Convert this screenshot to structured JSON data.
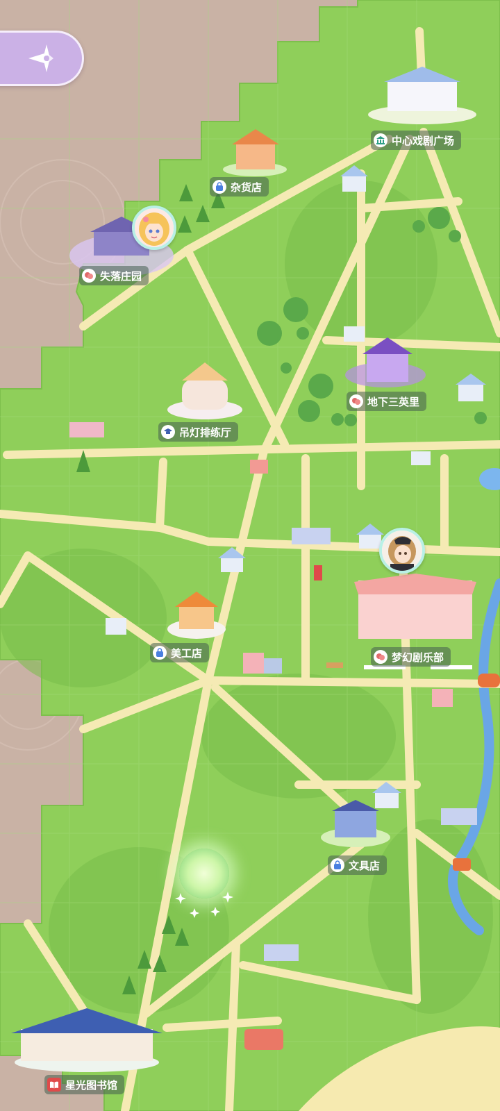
{
  "locations": {
    "central_theater_square": "中心戏剧广场",
    "general_store": "杂货店",
    "lost_manor": "失落庄园",
    "underground_three_miles": "地下三英里",
    "chandelier_rehearsal_hall": "吊灯排练厅",
    "art_supply_store": "美工店",
    "dream_theater_club": "梦幻剧乐部",
    "stationery_store": "文具店",
    "starlight_library": "星光图书馆"
  },
  "icons": {
    "back": "compass-back-icon",
    "landmark": "landmark-icon",
    "shop": "shopping-bag-icon",
    "theater": "theater-mask-icon",
    "school": "graduation-cap-icon",
    "book": "book-icon"
  },
  "colors": {
    "grass": "#8fcf5a",
    "grass_dark": "#6fb54a",
    "road": "#f5eab4",
    "ground": "#c9b2a5",
    "label_bg": "#465f50",
    "label_icon_blue": "#4a7fe0",
    "label_icon_red": "#e06a6a",
    "label_icon_green": "#3aa87a"
  }
}
